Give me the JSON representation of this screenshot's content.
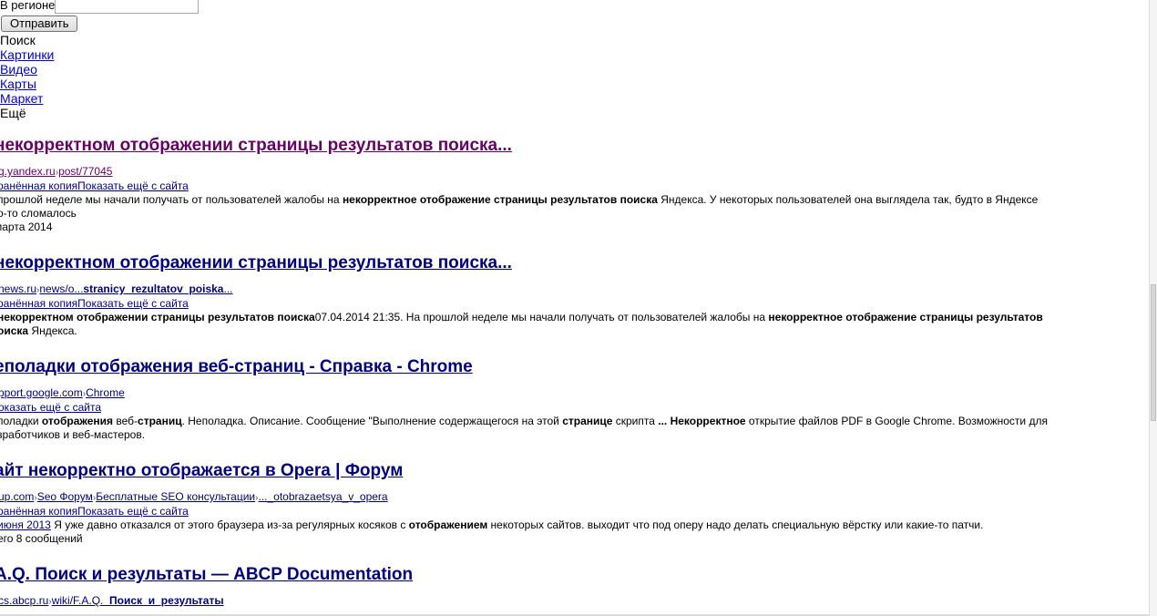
{
  "form": {
    "region_label": "В регионе",
    "region_value": "",
    "submit_label": "Отправить"
  },
  "nav": {
    "current": "Поиск",
    "links": [
      "Картинки",
      "Видео",
      "Карты",
      "Маркет"
    ],
    "more": "Ещё"
  },
  "results": [
    {
      "title": "некорректном отображении страницы результатов поиска...",
      "url_parts": [
        "g.yandex.ru",
        "post/77045"
      ],
      "cached_label": "хранённая копия",
      "more_label": "Показать ещё с сайта",
      "snippet": [
        {
          "t": "прошлой неделе мы начали получать от пользователей жалобы на ",
          "b": false
        },
        {
          "t": "некорректное отображение страницы результатов поиска",
          "b": true
        },
        {
          "t": " Яндекса. У некоторых пользователей она выглядела так, будто в Яндексе",
          "b": false
        }
      ],
      "snippet_line2": "о-то сломалось",
      "date": "марта 2014"
    },
    {
      "title": "некорректном отображении страницы результатов поиска...",
      "url_parts": [
        "news.ru",
        "news/o...",
        "stranicy_rezultatov_poiska",
        "..."
      ],
      "cached_label": "хранённая копия",
      "more_label": "Показать ещё с сайта",
      "snippet": [
        {
          "t": "некорректном отображении страницы результатов поиска",
          "b": true
        },
        {
          "t": "07.04.2014 21:35. На прошлой неделе мы начали получать от пользователей жалобы на ",
          "b": false
        },
        {
          "t": "некорректное отображение страницы результатов",
          "b": true
        }
      ],
      "snippet_line2_bold": "оиска",
      "snippet_line2": " Яндекса."
    },
    {
      "title": "еполадки отображения веб-страниц - Справка - Chrome",
      "url_parts": [
        "pport.google.com",
        "Chrome"
      ],
      "more_label": "оказать ещё с сайта",
      "snippet": [
        {
          "t": "полaдки ",
          "b": false
        },
        {
          "t": "отображения",
          "b": true
        },
        {
          "t": " веб-",
          "b": false
        },
        {
          "t": "страниц",
          "b": true
        },
        {
          "t": ". Неполадка. Описание. Сообщение \"Выполнение содержащегося на этой ",
          "b": false
        },
        {
          "t": "странице",
          "b": true
        },
        {
          "t": " скрипта ",
          "b": false
        },
        {
          "t": "... Некорректное",
          "b": true
        },
        {
          "t": " открытие файлов PDF в Google Chrome. Возможности для",
          "b": false
        }
      ],
      "snippet_line2": "зработчиков и веб-мастеров."
    },
    {
      "title": "айт некорректно отображается в Opera | Форум",
      "url_parts": [
        "up.com",
        "Seo Форум",
        "Бесплатные SEO консультации",
        "..._otobrazaetsya_v_opera"
      ],
      "cached_label": "хранённая копия",
      "more_label": "Показать ещё с сайта",
      "date_link": "июня 2013",
      "snippet": [
        {
          "t": " Я уже давно отказался от этого браузера из-за регулярных косяков с ",
          "b": false
        },
        {
          "t": "отображением",
          "b": true
        },
        {
          "t": " некоторых сайтов. выходит что под оперу надо делать специальную вёрстку или какие-то патчи.",
          "b": false
        }
      ],
      "meta": "его 8 сообщений"
    },
    {
      "title": "A.Q. Поиск и результаты — ABCP Documentation",
      "url_parts": [
        "cs.abcp.ru",
        "wiki/F.A.Q.",
        "_Поиск_и_результаты"
      ]
    }
  ]
}
